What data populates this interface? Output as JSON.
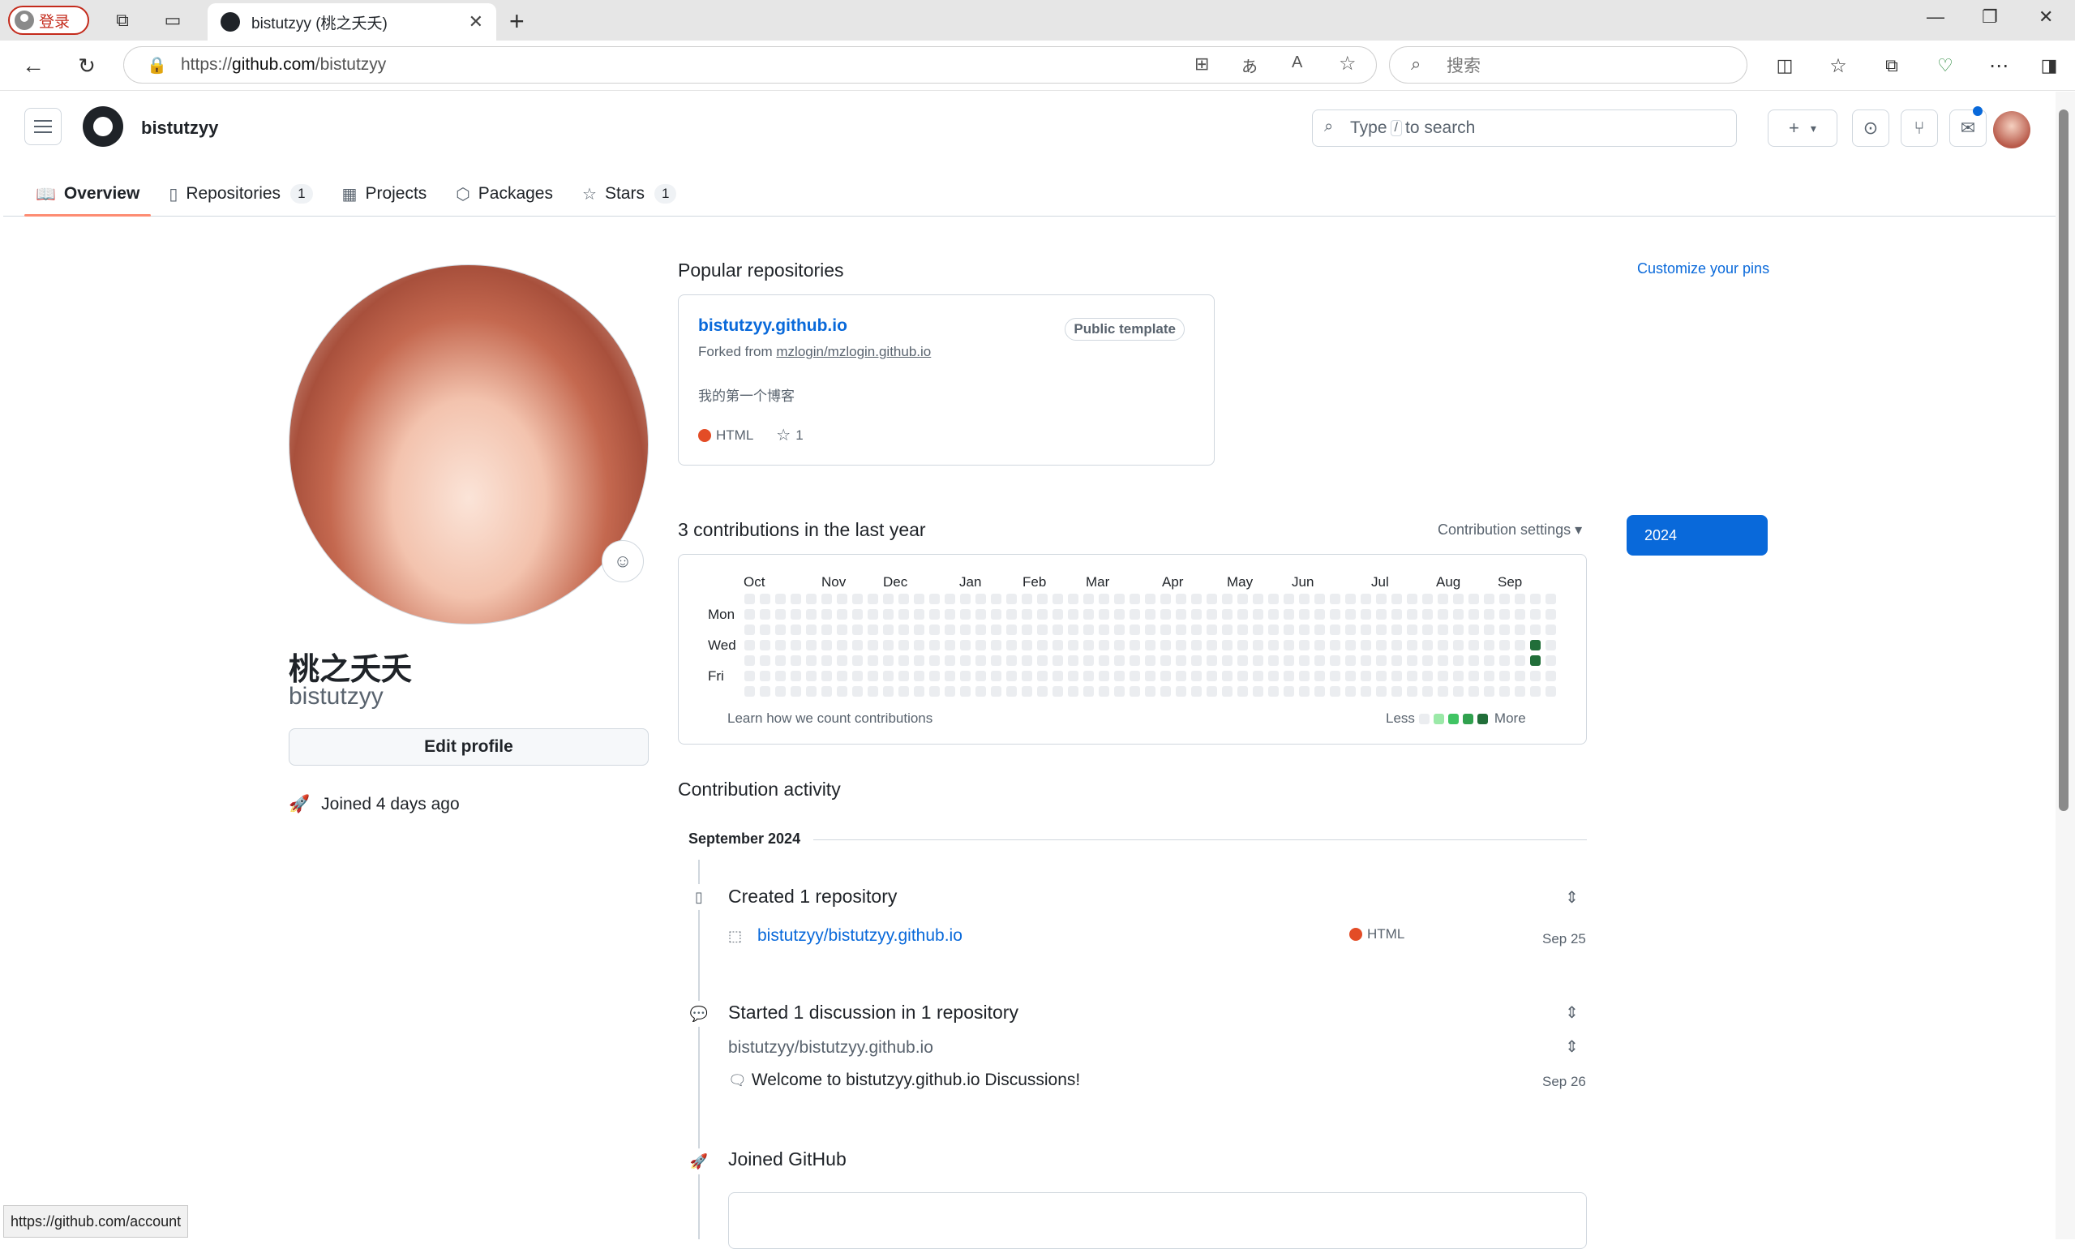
{
  "browser": {
    "profile_label": "登录",
    "tab_title": "bistutzyy (桃之夭夭)",
    "url_prefix": "https://",
    "url_host": "github.com",
    "url_path": "/bistutzyy",
    "search_placeholder": "搜索"
  },
  "header": {
    "username": "bistutzyy",
    "search_prefix": "Type",
    "search_key": "/",
    "search_suffix": "to search"
  },
  "nav": {
    "overview": "Overview",
    "repositories": "Repositories",
    "repositories_count": "1",
    "projects": "Projects",
    "packages": "Packages",
    "stars": "Stars",
    "stars_count": "1"
  },
  "profile": {
    "name": "桃之夭夭",
    "login": "bistutzyy",
    "edit_button": "Edit profile",
    "joined": "Joined 4 days ago"
  },
  "pins": {
    "title": "Popular repositories",
    "customize": "Customize your pins",
    "repo_name": "bistutzyy.github.io",
    "badge": "Public template",
    "forked_prefix": "Forked from",
    "forked_source": "mzlogin/mzlogin.github.io",
    "description": "我的第一个博客",
    "language": "HTML",
    "stars": "1"
  },
  "contributions": {
    "title": "3 contributions in the last year",
    "settings": "Contribution settings ▾",
    "year": "2024",
    "months": [
      "Oct",
      "Nov",
      "Dec",
      "Jan",
      "Feb",
      "Mar",
      "Apr",
      "May",
      "Jun",
      "Jul",
      "Aug",
      "Sep"
    ],
    "days": [
      "Mon",
      "Wed",
      "Fri"
    ],
    "learn": "Learn how we count contributions",
    "less": "Less",
    "more": "More",
    "colors": [
      "#ebedf0",
      "#9be9a8",
      "#40c463",
      "#30a14e",
      "#216e39"
    ]
  },
  "activity": {
    "title": "Contribution activity",
    "period": "September 2024",
    "created_title": "Created 1 repository",
    "created_repo": "bistutzyy/bistutzyy.github.io",
    "created_lang": "HTML",
    "created_date": "Sep 25",
    "discussion_title": "Started 1 discussion in 1 repository",
    "discussion_repo": "bistutzyy/bistutzyy.github.io",
    "discussion_item": "Welcome to bistutzyy.github.io Discussions!",
    "discussion_date": "Sep 26",
    "joined_title": "Joined GitHub"
  },
  "status_bar": {
    "url": "https://github.com/account"
  }
}
